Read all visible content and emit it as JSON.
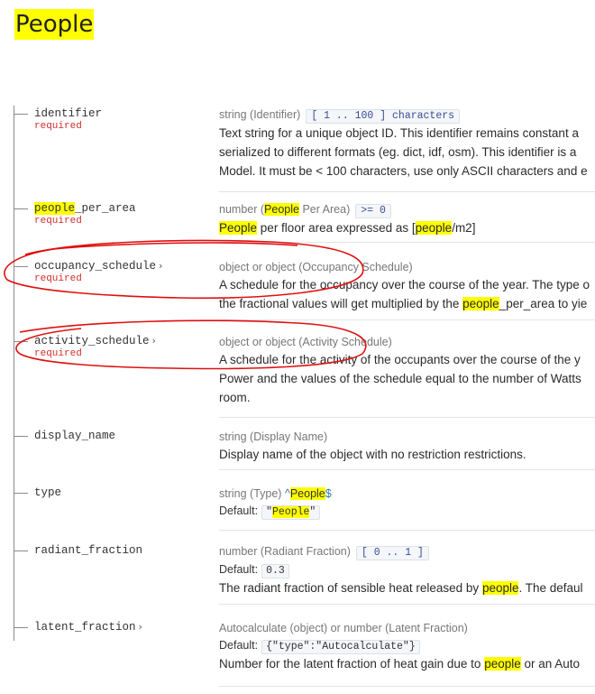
{
  "page_title": "People",
  "properties": [
    {
      "name": "identifier",
      "required": "required",
      "type": "string (Identifier)",
      "constraint": "[ 1 .. 100 ] characters",
      "description_lines": [
        "Text string for a unique object ID. This identifier remains constant a",
        "serialized to different formats (eg. dict, idf, osm). This identifier is a",
        "Model. It must be < 100 characters, use only ASCII characters and e"
      ]
    },
    {
      "name_highlight": "people",
      "name_rest": "_per_area",
      "required": "required",
      "type_prefix": "number (",
      "type_highlight": "People",
      "type_suffix": " Per Area)",
      "constraint": ">= 0",
      "desc_highlight": "People",
      "desc_mid": " per floor area expressed as [",
      "desc_highlight2": "people",
      "desc_end": "/m2]"
    },
    {
      "name": "occupancy_schedule",
      "chevron": "›",
      "required": "required",
      "type": "object or object (Occupancy Schedule)",
      "line1": "A schedule for the occupancy over the course of the year. The type o",
      "line2_pre": "the fractional values will get multiplied by the ",
      "line2_highlight": "people",
      "line2_post": "_per_area to yie"
    },
    {
      "name": "activity_schedule",
      "chevron": "›",
      "required": "required",
      "type": "object or object (Activity Schedule)",
      "description_lines": [
        "A schedule for the activity of the occupants over the course of the y",
        "Power and the values of the schedule equal to the number of Watts",
        "room."
      ]
    },
    {
      "name": "display_name",
      "type": "string (Display Name)",
      "description": "Display name of the object with no restriction restrictions."
    },
    {
      "name": "type",
      "type": "string (Type)",
      "pattern_pre": "^",
      "pattern_highlight": "People",
      "pattern_post": "$",
      "default_label": "Default:",
      "default_pre": "\"",
      "default_highlight": "People",
      "default_post": "\""
    },
    {
      "name": "radiant_fraction",
      "type": "number (Radiant Fraction)",
      "constraint": "[ 0 .. 1 ]",
      "default_label": "Default:",
      "default_value": "0.3",
      "desc_pre": "The radiant fraction of sensible heat released by ",
      "desc_highlight": "people",
      "desc_post": ". The defaul"
    },
    {
      "name": "latent_fraction",
      "chevron": "›",
      "type": "Autocalculate (object) or number (Latent Fraction)",
      "default_label": "Default:",
      "default_value": "{\"type\":\"Autocalculate\"}",
      "desc_pre": "Number for the latent fraction of heat gain due to ",
      "desc_highlight": "people",
      "desc_post": " or an Auto"
    }
  ],
  "colors": {
    "highlight": "#ffff00",
    "required": "#d42c2c",
    "annotation": "#e01010",
    "constraint_text": "#3a4c94"
  }
}
